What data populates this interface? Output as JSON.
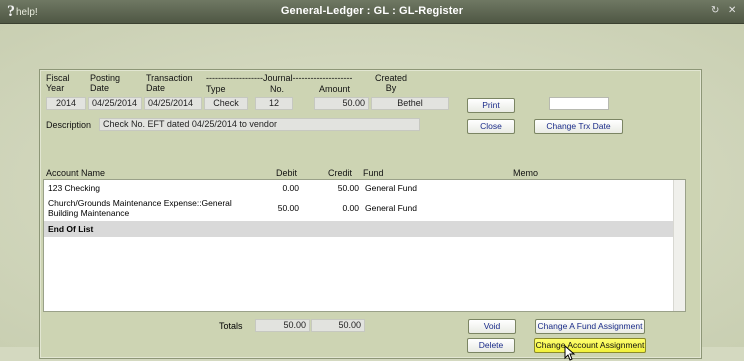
{
  "window": {
    "help_label": "help!",
    "title": "General-Ledger : GL : GL-Register",
    "refresh_glyph": "↻",
    "close_glyph": "✕"
  },
  "header": {
    "fiscal_year_label": "Fiscal Year",
    "posting_date_label": "Posting Date",
    "transaction_date_label": "Transaction Date",
    "journal_group_label": "-------------------Journal--------------------",
    "type_label": "Type",
    "no_label": "No.",
    "amount_label": "Amount",
    "created_by_label": "Created By"
  },
  "fields": {
    "fiscal_year": "2014",
    "posting_date": "04/25/2014",
    "transaction_date": "04/25/2014",
    "journal_type": "Check",
    "journal_no": "12",
    "amount": "50.00",
    "created_by": "Bethel",
    "blank_field": "",
    "description_label": "Description",
    "description": "Check No. EFT dated 04/25/2014 to vendor"
  },
  "buttons": {
    "print": "Print",
    "close": "Close",
    "change_trx_date": "Change Trx Date",
    "void": "Void",
    "delete": "Delete",
    "change_fund_assignment": "Change A Fund Assignment",
    "change_account_assignment": "Change Account Assignment"
  },
  "grid": {
    "columns": {
      "account_name": "Account Name",
      "debit": "Debit",
      "credit": "Credit",
      "fund": "Fund",
      "memo": "Memo"
    },
    "rows": [
      {
        "account": "123 Checking",
        "account_line2": "",
        "debit": "0.00",
        "credit": "50.00",
        "fund": "General Fund"
      },
      {
        "account": "Church/Grounds Maintenance Expense::General",
        "account_line2": "Building Maintenance",
        "debit": "50.00",
        "credit": "0.00",
        "fund": "General Fund"
      }
    ],
    "end_label": "End Of List"
  },
  "totals": {
    "label": "Totals",
    "debit": "50.00",
    "credit": "50.00"
  },
  "colors": {
    "titlebar": "#5f6854",
    "panel": "#cdd4b3",
    "highlight_button": "#f5f542",
    "button_text": "#1a2b8a"
  }
}
